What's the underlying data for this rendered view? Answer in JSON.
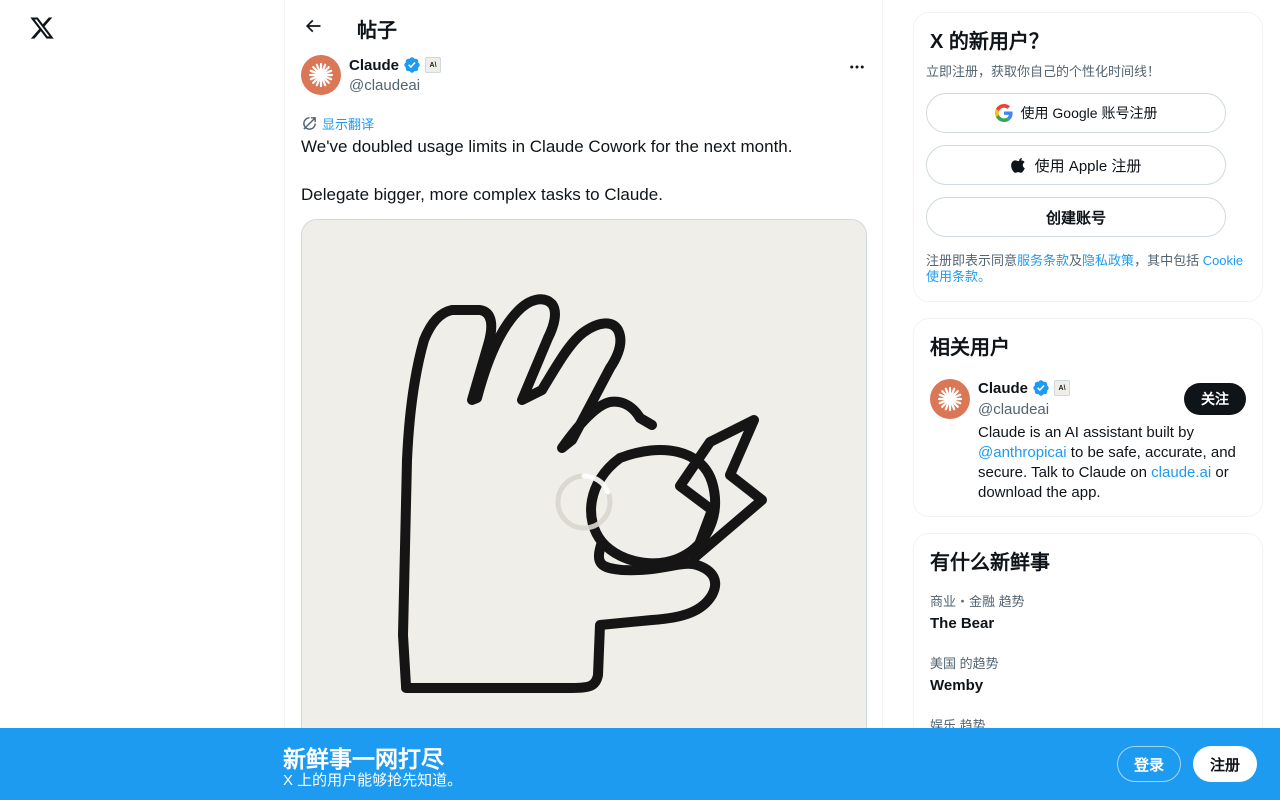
{
  "nav": {
    "logo_icon": "x-logo-icon"
  },
  "header": {
    "title": "帖子",
    "back_icon": "arrow-left-icon"
  },
  "tweet": {
    "author_name": "Claude",
    "author_handle": "@claudeai",
    "verified": true,
    "affiliate_badge": "A\\",
    "translate_label": "显示翻译",
    "paragraphs": [
      "We've doubled usage limits in Claude Cowork for the next month.",
      "Delegate bigger, more complex tasks to Claude."
    ],
    "media": {
      "loading": true,
      "background": "#f0eee9"
    }
  },
  "sidebar": {
    "signup": {
      "title": "X 的新用户？",
      "subtitle": "立即注册，获取你自己的个性化时间线！",
      "google_label": "使用 Google 账号注册",
      "apple_label": "使用 Apple 注册",
      "create_label": "创建账号",
      "terms_prefix": "注册即表示同意",
      "terms_link": "服务条款",
      "terms_and": "及",
      "privacy_link": "隐私政策",
      "terms_mid": "，其中包括 ",
      "cookie_link": "Cookie 使用条款",
      "terms_end": "。"
    },
    "related": {
      "title": "相关用户",
      "name": "Claude",
      "handle": "@claudeai",
      "affiliate_badge": "A\\",
      "follow_label": "关注",
      "bio_1": "Claude is an AI assistant built by ",
      "bio_link_1": "@anthropicai",
      "bio_2": " to be safe, accurate, and secure. Talk to Claude on ",
      "bio_link_2": "claude.ai",
      "bio_3": " or download the app."
    },
    "trends": {
      "title": "有什么新鲜事",
      "items": [
        {
          "meta": "商业・金融 趋势",
          "name": "The Bear"
        },
        {
          "meta": "美国 的趋势",
          "name": "Wemby"
        },
        {
          "meta": "娱乐 趋势",
          "name": ""
        }
      ]
    }
  },
  "bottom_bar": {
    "title": "新鲜事一网打尽",
    "subtitle": "X 上的用户能够抢先知道。",
    "login_label": "登录",
    "register_label": "注册"
  },
  "colors": {
    "accent": "#1d9bf0",
    "claude_orange": "#d97757",
    "text_primary": "#0f1419",
    "text_secondary": "#536471"
  }
}
